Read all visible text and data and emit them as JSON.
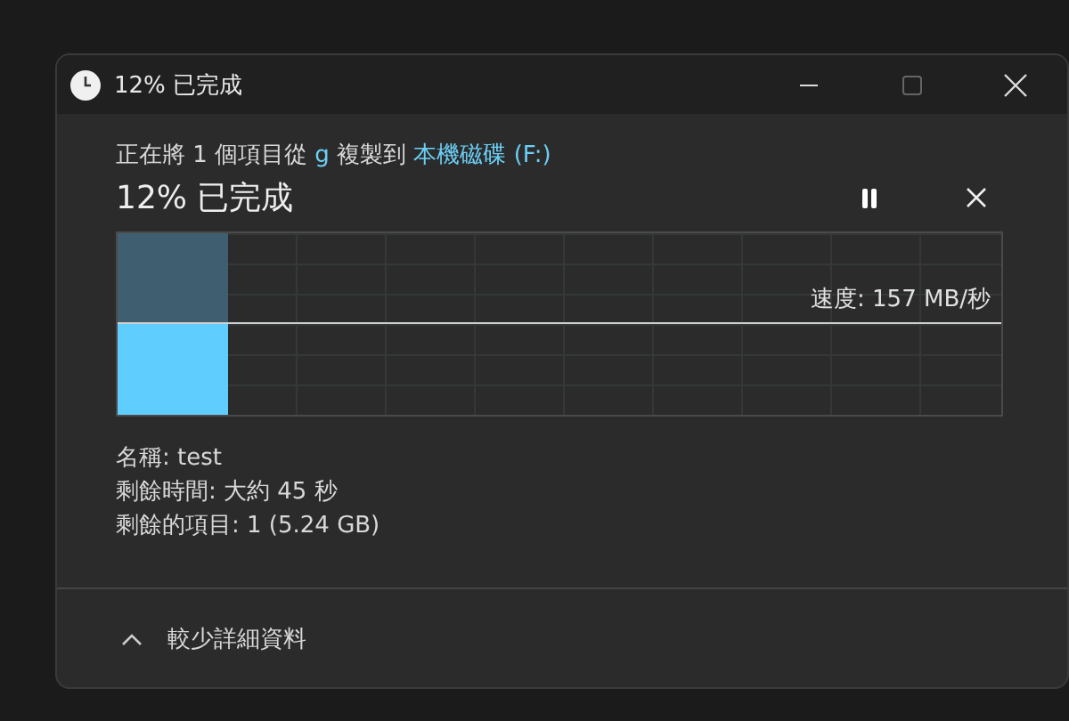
{
  "window": {
    "title": "12% 已完成"
  },
  "header": {
    "parts": [
      {
        "kind": "plain",
        "text": "正在將 1 個項目從 "
      },
      {
        "kind": "link",
        "text": "g"
      },
      {
        "kind": "plain",
        "text": " 複製到 "
      },
      {
        "kind": "link",
        "text": "本機磁碟 (F:)"
      }
    ]
  },
  "progress": {
    "title": "12% 已完成",
    "speed": "速度: 157 MB/秒"
  },
  "details": [
    "名稱: test",
    "剩餘時間: 大約 45 秒",
    "剩餘的項目: 1 (5.24 GB)"
  ],
  "footer": {
    "label": "較少詳細資料",
    "expanded": true
  }
}
